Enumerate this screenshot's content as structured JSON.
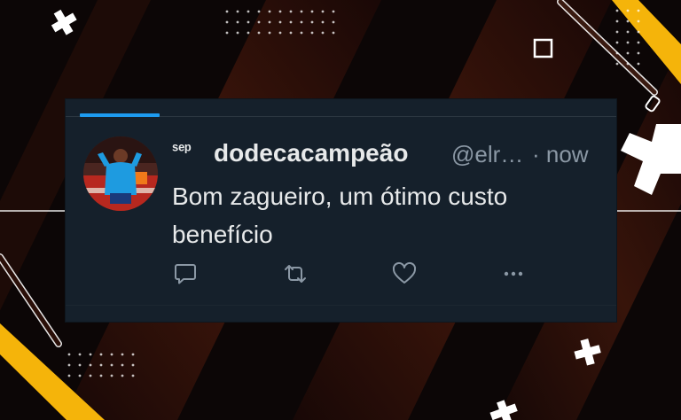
{
  "tweet": {
    "name_prefix": "ˢᵉᵖ",
    "display_name": "dodecacampeão",
    "handle": "@elr…",
    "timestamp": "· now",
    "text": "Bom zagueiro, um ótimo custo benefício"
  },
  "actions": {
    "reply_icon": "reply-icon",
    "retweet_icon": "retweet-icon",
    "like_icon": "heart-icon",
    "more_icon": "more-icon"
  },
  "colors": {
    "background": "#0c0606",
    "card": "#15202b",
    "accent": "#1d9bf0",
    "secondary_text": "#8b98a5",
    "decor_yellow": "#f5b40a"
  }
}
